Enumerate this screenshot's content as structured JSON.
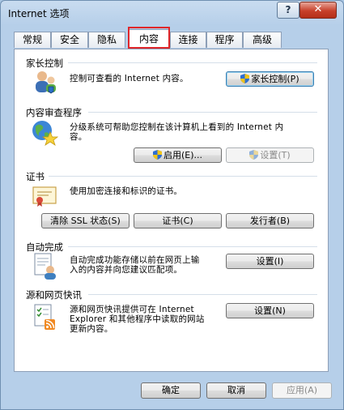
{
  "window": {
    "title": "Internet 选项",
    "help_glyph": "?",
    "close_glyph": "✕"
  },
  "tabs": [
    "常规",
    "安全",
    "隐私",
    "内容",
    "连接",
    "程序",
    "高级"
  ],
  "active_tab": "内容",
  "parental": {
    "header": "家长控制",
    "desc": "控制可查看的 Internet 内容。",
    "button": "家长控制(P)"
  },
  "advisor": {
    "header": "内容审查程序",
    "desc_line1": "分级系统可帮助您控制在该计算机上看到的 Internet 内",
    "desc_line2": "容。",
    "enable_button": "启用(E)...",
    "settings_button": "设置(T)"
  },
  "certificates": {
    "header": "证书",
    "desc": "使用加密连接和标识的证书。",
    "clear_ssl_button": "清除 SSL 状态(S)",
    "certificates_button": "证书(C)",
    "publishers_button": "发行者(B)"
  },
  "autocomplete": {
    "header": "自动完成",
    "desc_line1": "自动完成功能存储以前在网页上输",
    "desc_line2": "入的内容并向您建议匹配项。",
    "settings_button": "设置(I)"
  },
  "feeds": {
    "header": "源和网页快讯",
    "desc_line1": "源和网页快讯提供可在 Internet",
    "desc_line2": "Explorer 和其他程序中读取的网站",
    "desc_line3": "更新内容。",
    "settings_button": "设置(N)"
  },
  "footer": {
    "ok": "确定",
    "cancel": "取消",
    "apply": "应用(A)"
  },
  "colors": {
    "highlight": "#e0262a",
    "title_bg": "#b6cfe9",
    "close": "#c7402a"
  }
}
